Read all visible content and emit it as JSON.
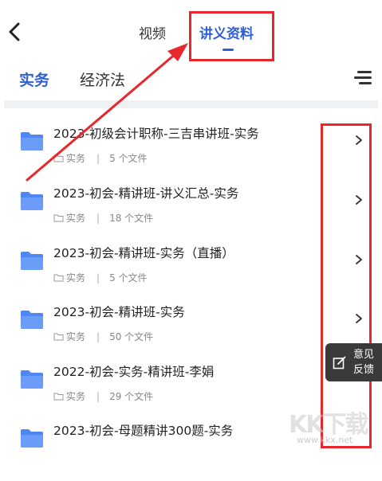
{
  "header": {
    "tabs": [
      {
        "label": "视频",
        "active": false
      },
      {
        "label": "讲义资料",
        "active": true
      }
    ]
  },
  "subjects": [
    {
      "label": "实务",
      "active": true
    },
    {
      "label": "经济法",
      "active": false
    }
  ],
  "files": [
    {
      "title": "2023-初级会计职称-三吉串讲班-实务",
      "category": "实务",
      "count": "5 个文件"
    },
    {
      "title": "2023-初会-精讲班-讲义汇总-实务",
      "category": "实务",
      "count": "18 个文件"
    },
    {
      "title": "2023-初会-精讲班-实务（直播）",
      "category": "实务",
      "count": "5 个文件"
    },
    {
      "title": "2023-初会-精讲班-实务",
      "category": "实务",
      "count": "50 个文件"
    },
    {
      "title": "2022-初会-实务-精讲班-李娟",
      "category": "实务",
      "count": "29 个文件"
    },
    {
      "title": "2023-初会-母题精讲300题-实务",
      "category": "",
      "count": ""
    }
  ],
  "feedback": {
    "label_line1": "意见",
    "label_line2": "反馈"
  },
  "watermark": {
    "text": "KK下载",
    "url": "www.kkx.net"
  },
  "colors": {
    "accent": "#2f5fd6",
    "annotation": "#e8262b",
    "folder": "#5b8ff5"
  },
  "icons": {
    "back": "chevron-left-icon",
    "menu": "filter-menu-icon",
    "folder": "folder-icon",
    "row_arrow": "chevron-right-icon",
    "feedback": "edit-icon"
  }
}
